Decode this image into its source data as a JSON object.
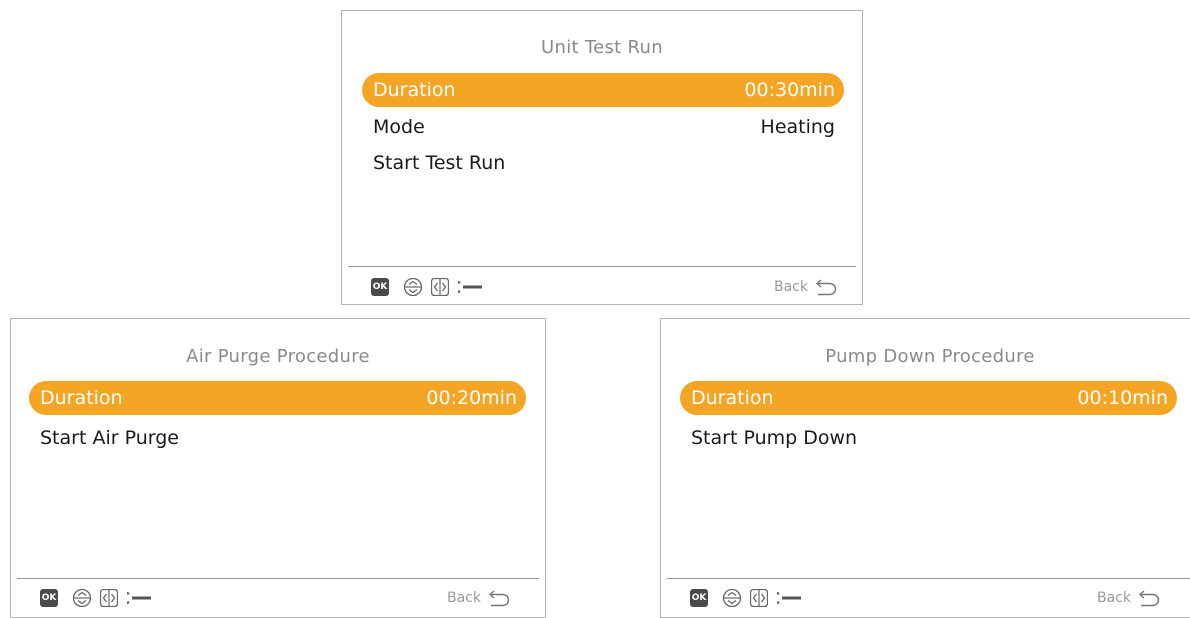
{
  "screens": [
    {
      "title": "Unit Test Run",
      "rows": [
        {
          "label": "Duration",
          "value": "00:30min"
        },
        {
          "label": "Mode",
          "value": "Heating"
        },
        {
          "label": "Start Test Run",
          "value": ""
        }
      ],
      "back_label": "Back"
    },
    {
      "title": "Air Purge Procedure",
      "rows": [
        {
          "label": "Duration",
          "value": "00:20min"
        },
        {
          "label": "Start Air Purge",
          "value": ""
        }
      ],
      "back_label": "Back"
    },
    {
      "title": "Pump Down Procedure",
      "rows": [
        {
          "label": "Duration",
          "value": "00:10min"
        },
        {
          "label": "Start Pump Down",
          "value": ""
        }
      ],
      "back_label": "Back"
    }
  ],
  "footer_icons": [
    "ok-icon",
    "up-down-arrows-icon",
    "left-right-arrows-icon",
    "wrench-icon",
    "back-arrow-icon"
  ],
  "footer_ok_text": "OK",
  "colors": {
    "highlight": "#f5a524",
    "border": "#b5b5b5",
    "title": "#8a8a8a",
    "text": "#1a1a1a"
  }
}
